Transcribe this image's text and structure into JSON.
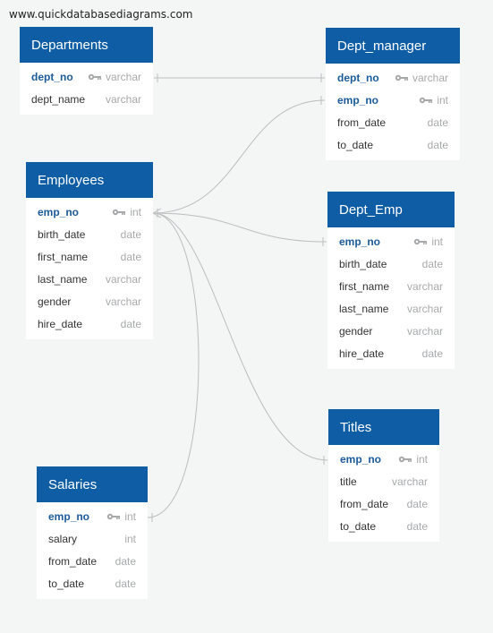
{
  "watermark": "www.quickdatabasediagrams.com",
  "colors": {
    "header": "#0e5da5",
    "pk_text": "#1b5b99",
    "type_text": "#a7a9ab",
    "connector": "#bbbdbf",
    "background": "#f4f5f5"
  },
  "tables": [
    {
      "id": "departments",
      "title": "Departments",
      "fields": [
        {
          "name": "dept_no",
          "type": "varchar",
          "pk": true
        },
        {
          "name": "dept_name",
          "type": "varchar",
          "pk": false
        }
      ]
    },
    {
      "id": "dept_manager",
      "title": "Dept_manager",
      "fields": [
        {
          "name": "dept_no",
          "type": "varchar",
          "pk": true
        },
        {
          "name": "emp_no",
          "type": "int",
          "pk": true
        },
        {
          "name": "from_date",
          "type": "date",
          "pk": false
        },
        {
          "name": "to_date",
          "type": "date",
          "pk": false
        }
      ]
    },
    {
      "id": "employees",
      "title": "Employees",
      "fields": [
        {
          "name": "emp_no",
          "type": "int",
          "pk": true
        },
        {
          "name": "birth_date",
          "type": "date",
          "pk": false
        },
        {
          "name": "first_name",
          "type": "date",
          "pk": false
        },
        {
          "name": "last_name",
          "type": "varchar",
          "pk": false
        },
        {
          "name": "gender",
          "type": "varchar",
          "pk": false
        },
        {
          "name": "hire_date",
          "type": "date",
          "pk": false
        }
      ]
    },
    {
      "id": "dept_emp",
      "title": "Dept_Emp",
      "fields": [
        {
          "name": "emp_no",
          "type": "int",
          "pk": true
        },
        {
          "name": "birth_date",
          "type": "date",
          "pk": false
        },
        {
          "name": "first_name",
          "type": "varchar",
          "pk": false
        },
        {
          "name": "last_name",
          "type": "varchar",
          "pk": false
        },
        {
          "name": "gender",
          "type": "varchar",
          "pk": false
        },
        {
          "name": "hire_date",
          "type": "date",
          "pk": false
        }
      ]
    },
    {
      "id": "titles",
      "title": "Titles",
      "fields": [
        {
          "name": "emp_no",
          "type": "int",
          "pk": true
        },
        {
          "name": "title",
          "type": "varchar",
          "pk": false
        },
        {
          "name": "from_date",
          "type": "date",
          "pk": false
        },
        {
          "name": "to_date",
          "type": "date",
          "pk": false
        }
      ]
    },
    {
      "id": "salaries",
      "title": "Salaries",
      "fields": [
        {
          "name": "emp_no",
          "type": "int",
          "pk": true
        },
        {
          "name": "salary",
          "type": "int",
          "pk": false
        },
        {
          "name": "from_date",
          "type": "date",
          "pk": false
        },
        {
          "name": "to_date",
          "type": "date",
          "pk": false
        }
      ]
    }
  ],
  "relationships": [
    {
      "from": "departments.dept_no",
      "to": "dept_manager.dept_no",
      "from_end": "one",
      "to_end": "one"
    },
    {
      "from": "employees.emp_no",
      "to": "dept_manager.emp_no",
      "from_end": "many",
      "to_end": "one"
    },
    {
      "from": "employees.emp_no",
      "to": "dept_emp.emp_no",
      "from_end": "many",
      "to_end": "one"
    },
    {
      "from": "employees.emp_no",
      "to": "titles.emp_no",
      "from_end": "many",
      "to_end": "one"
    },
    {
      "from": "employees.emp_no",
      "to": "salaries.emp_no",
      "from_end": "many",
      "to_end": "one"
    }
  ]
}
